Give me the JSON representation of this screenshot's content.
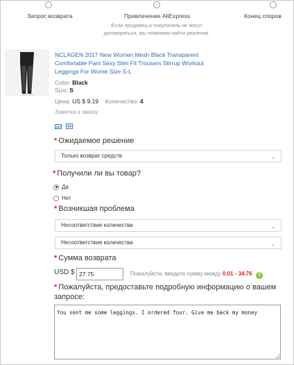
{
  "steps": [
    {
      "label": "Запрос возврата"
    },
    {
      "label": "Привлечение AliExpress",
      "description": "Если продавец и покупатель не могут договориться, мы поможем найти решение."
    },
    {
      "label": "Конец споров"
    }
  ],
  "product": {
    "title": "NCLAGEN 2017 New Women Mesh Black Transparent Comfortable Pant Sexy Slim Fit Trousers Stirrup Workout Leggings For Wome Size S-L",
    "color_label": "Color:",
    "color_value": "Black",
    "size_label": "Size:",
    "size_value": "S",
    "price_label": "Цена:",
    "price_value": "US $ 9.19",
    "qty_label": "Количество:",
    "qty_value": "4",
    "note": "Заметка к заказу"
  },
  "form": {
    "required_mark": "*",
    "expected_label": "Ожидаемое решение",
    "expected_value": "Только возврат средств",
    "received_label": "Получили ли вы товар?",
    "received_options": [
      "Да",
      "Нет"
    ],
    "received_selected": "Да",
    "problem_label": "Возникшая проблема",
    "problem_value_1": "Несоответствие количества",
    "problem_value_2": "Несоответствие количества",
    "amount_label": "Сумма возврата",
    "currency": "USD $",
    "amount_value": "27.75",
    "amount_hint": "Пожалуйста, введите сумму между",
    "amount_range": "0.01 - 34.76",
    "help_glyph": "?",
    "details_label": "Пожалуйста, предоставьте подробную информацию о вашем запросе:",
    "details_value": "You sent me some leggings. I ordered four. Give me back my money"
  },
  "chevron_glyph": "⌄",
  "colors": {
    "link": "#2e6db3",
    "required": "#e0201c",
    "help": "#8dc63f"
  },
  "icons": [
    "photo-icon",
    "document-icon",
    "help-icon",
    "chevron-down-icon"
  ]
}
